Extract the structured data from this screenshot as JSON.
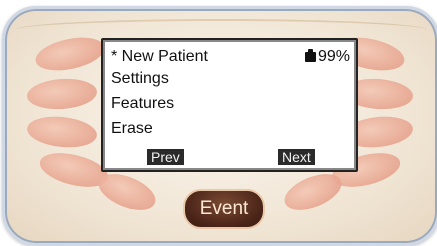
{
  "screen": {
    "menu": [
      {
        "label": "* New Patient"
      },
      {
        "label": "Settings"
      },
      {
        "label": "Features"
      },
      {
        "label": "Erase"
      }
    ],
    "battery": {
      "level_text": "99%",
      "icon": "battery-icon"
    },
    "soft_keys": {
      "prev_label": "Prev",
      "next_label": "Next"
    }
  },
  "buttons": {
    "event_label": "Event"
  },
  "colors": {
    "body": "#f1e6d6",
    "petals": "#e7a58f",
    "event_button": "#4a2418",
    "soft_key": "#2a2a2a"
  }
}
